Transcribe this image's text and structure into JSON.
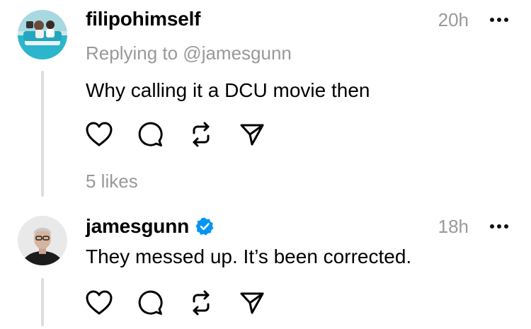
{
  "posts": [
    {
      "username": "filipohimself",
      "verified": false,
      "timestamp": "20h",
      "replying_to": "Replying to @jamesgunn",
      "text": "Why calling it a DCU movie then",
      "likes": "5 likes",
      "avatar_icon": "avatar-photo-icon"
    },
    {
      "username": "jamesgunn",
      "verified": true,
      "timestamp": "18h",
      "text": "They messed up. It’s been corrected.",
      "avatar_icon": "avatar-photo-icon"
    }
  ],
  "actions": [
    "heart-icon",
    "comment-icon",
    "repost-icon",
    "share-icon"
  ],
  "colors": {
    "text": "#000000",
    "muted": "#999999",
    "thread_line": "#dddddd",
    "verified": "#0095f6"
  }
}
